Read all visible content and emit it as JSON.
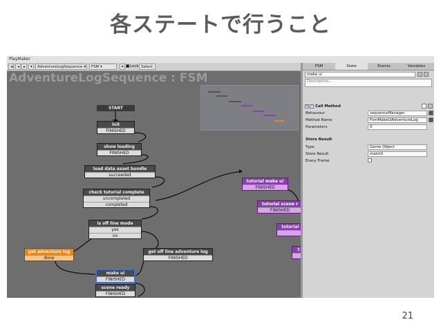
{
  "slide": {
    "title": "各ステートで行うこと",
    "page_number": "21"
  },
  "window": {
    "title": "PlayMaker"
  },
  "toolbar": {
    "sequence": "AdventureLogSequence",
    "fsm": "FSM",
    "lock": "Lock",
    "select": "Select"
  },
  "canvas": {
    "title": "AdventureLogSequence : FSM"
  },
  "nodes": {
    "start": "START",
    "init": {
      "name": "init",
      "event": "FINISHED"
    },
    "show_loading": {
      "name": "show loading",
      "event": "FINISHED"
    },
    "load_data": {
      "name": "load data asset bundle",
      "event": "succeeded"
    },
    "check_tutorial": {
      "name": "check tutorial complete",
      "events": [
        "uncompleted",
        "completed"
      ]
    },
    "is_offline": {
      "name": "is off line mode",
      "events": [
        "yes",
        "no"
      ]
    },
    "get_adventure_log": {
      "name": "get adventure log",
      "event": "done"
    },
    "get_offline_log": {
      "name": "get off line adventure log",
      "event": "FINISHED"
    },
    "make_ui": {
      "name": "make ui",
      "event": "FINISHED"
    },
    "scene_ready": {
      "name": "scene ready",
      "event": "FINISHED"
    },
    "tutorial_make_ui": {
      "name": "tutorial make ui",
      "event": "FINISHED"
    },
    "tutorial_scene": {
      "name": "tutorial scene r",
      "event": "FINISHED"
    },
    "tutorial_3": {
      "name": "tutorial",
      "event": ""
    },
    "tutorial_4": {
      "name": "t",
      "event": ""
    }
  },
  "inspector": {
    "tabs": [
      "FSM",
      "State",
      "Events",
      "Variables"
    ],
    "state_name": "make ui",
    "description_placeholder": "Description...",
    "action_title": "Call Method",
    "labels": {
      "behaviour": "Behaviour",
      "method_name": "Method Name",
      "parameters": "Parameters",
      "store_result": "Store Result",
      "type": "Type",
      "store_result_field": "Store Result",
      "every_frame": "Every Frame"
    },
    "values": {
      "behaviour": "sequenceManager",
      "method_name": "FsmMakeUiAdventureLog",
      "parameters": "0",
      "type": "Game Object",
      "store_result": "mainUi"
    }
  },
  "colors": {
    "canvas_bg": "#6e6e6e",
    "node_header": "#4a4a4a",
    "orange_node": "#e8861f",
    "purple_node": "#8a3fb0",
    "selected_border": "#3b6fd4"
  }
}
